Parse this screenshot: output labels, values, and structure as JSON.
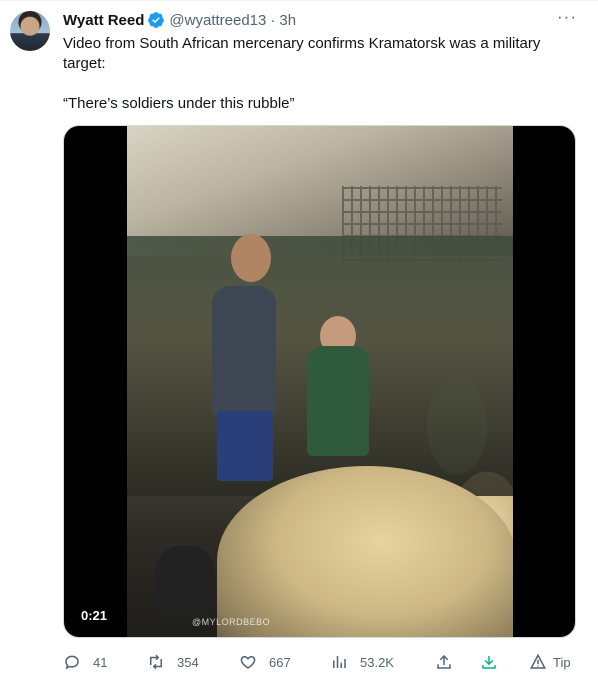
{
  "author": {
    "name": "Wyatt Reed",
    "handle": "@wyattreed13",
    "separator": "·",
    "time": "3h",
    "verified_color": "#1d9bf0"
  },
  "tweet": {
    "text_line": "Video from South African mercenary confirms Kramatorsk was a military target:",
    "quote_line": "“There’s soldiers under this rubble”"
  },
  "media": {
    "duration": "0:21",
    "watermark": "@MYLORDBEBO"
  },
  "actions": {
    "reply_count": "41",
    "retweet_count": "354",
    "like_count": "667",
    "views_count": "53.2K",
    "tip_label": "Tip"
  },
  "icons": {
    "more": "more-icon",
    "reply": "reply-icon",
    "retweet": "retweet-icon",
    "like": "heart-icon",
    "views": "views-chart-icon",
    "share": "share-icon",
    "download": "download-icon",
    "tip": "tip-icon"
  },
  "colors": {
    "text": "#0f1419",
    "secondary": "#536471",
    "download_green": "#00ba7c"
  }
}
